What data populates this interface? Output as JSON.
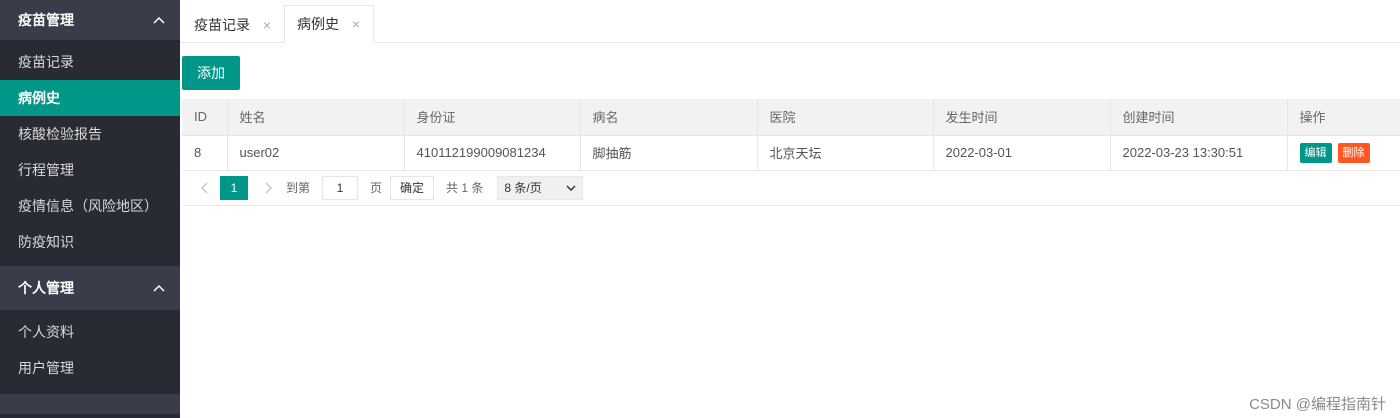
{
  "sidebar": {
    "groups": [
      {
        "title": "疫苗管理",
        "items": [
          {
            "label": "疫苗记录"
          },
          {
            "label": "病例史"
          },
          {
            "label": "核酸检验报告"
          },
          {
            "label": "行程管理"
          },
          {
            "label": "疫情信息（风险地区）"
          },
          {
            "label": "防疫知识"
          }
        ]
      },
      {
        "title": "个人管理",
        "items": [
          {
            "label": "个人资料"
          },
          {
            "label": "用户管理"
          }
        ]
      }
    ],
    "active_item": "病例史"
  },
  "tabs": [
    {
      "label": "疫苗记录",
      "close": "×"
    },
    {
      "label": "病例史",
      "close": "×"
    }
  ],
  "toolbar": {
    "add_label": "添加"
  },
  "table": {
    "columns": [
      "ID",
      "姓名",
      "身份证",
      "病名",
      "医院",
      "发生时间",
      "创建时间",
      "操作"
    ],
    "rows": [
      {
        "id": "8",
        "name": "user02",
        "id_card": "410112199009081234",
        "disease": "脚抽筋",
        "hospital": "北京天坛",
        "occurred": "2022-03-01",
        "created": "2022-03-23 13:30:51",
        "edit_label": "编辑",
        "delete_label": "删除"
      }
    ]
  },
  "pager": {
    "current_page": "1",
    "goto_prefix": "到第",
    "goto_value": "1",
    "goto_suffix": "页",
    "confirm_label": "确定",
    "total_text": "共 1 条",
    "page_size": "8 条/页"
  },
  "watermark": "CSDN @编程指南针",
  "colors": {
    "accent": "#009688",
    "danger": "#ff5722",
    "sidebar_bg": "#282b33",
    "sidebar_header_bg": "#393d49"
  }
}
